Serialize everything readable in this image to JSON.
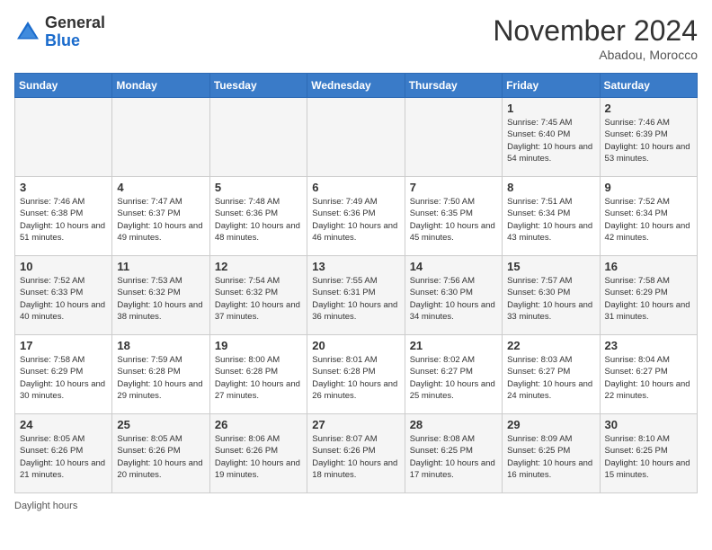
{
  "header": {
    "logo_general": "General",
    "logo_blue": "Blue",
    "month_title": "November 2024",
    "location": "Abadou, Morocco"
  },
  "footer": {
    "daylight_hours": "Daylight hours"
  },
  "weekdays": [
    "Sunday",
    "Monday",
    "Tuesday",
    "Wednesday",
    "Thursday",
    "Friday",
    "Saturday"
  ],
  "weeks": [
    [
      {
        "day": "",
        "info": ""
      },
      {
        "day": "",
        "info": ""
      },
      {
        "day": "",
        "info": ""
      },
      {
        "day": "",
        "info": ""
      },
      {
        "day": "",
        "info": ""
      },
      {
        "day": "1",
        "info": "Sunrise: 7:45 AM\nSunset: 6:40 PM\nDaylight: 10 hours and 54 minutes."
      },
      {
        "day": "2",
        "info": "Sunrise: 7:46 AM\nSunset: 6:39 PM\nDaylight: 10 hours and 53 minutes."
      }
    ],
    [
      {
        "day": "3",
        "info": "Sunrise: 7:46 AM\nSunset: 6:38 PM\nDaylight: 10 hours and 51 minutes."
      },
      {
        "day": "4",
        "info": "Sunrise: 7:47 AM\nSunset: 6:37 PM\nDaylight: 10 hours and 49 minutes."
      },
      {
        "day": "5",
        "info": "Sunrise: 7:48 AM\nSunset: 6:36 PM\nDaylight: 10 hours and 48 minutes."
      },
      {
        "day": "6",
        "info": "Sunrise: 7:49 AM\nSunset: 6:36 PM\nDaylight: 10 hours and 46 minutes."
      },
      {
        "day": "7",
        "info": "Sunrise: 7:50 AM\nSunset: 6:35 PM\nDaylight: 10 hours and 45 minutes."
      },
      {
        "day": "8",
        "info": "Sunrise: 7:51 AM\nSunset: 6:34 PM\nDaylight: 10 hours and 43 minutes."
      },
      {
        "day": "9",
        "info": "Sunrise: 7:52 AM\nSunset: 6:34 PM\nDaylight: 10 hours and 42 minutes."
      }
    ],
    [
      {
        "day": "10",
        "info": "Sunrise: 7:52 AM\nSunset: 6:33 PM\nDaylight: 10 hours and 40 minutes."
      },
      {
        "day": "11",
        "info": "Sunrise: 7:53 AM\nSunset: 6:32 PM\nDaylight: 10 hours and 38 minutes."
      },
      {
        "day": "12",
        "info": "Sunrise: 7:54 AM\nSunset: 6:32 PM\nDaylight: 10 hours and 37 minutes."
      },
      {
        "day": "13",
        "info": "Sunrise: 7:55 AM\nSunset: 6:31 PM\nDaylight: 10 hours and 36 minutes."
      },
      {
        "day": "14",
        "info": "Sunrise: 7:56 AM\nSunset: 6:30 PM\nDaylight: 10 hours and 34 minutes."
      },
      {
        "day": "15",
        "info": "Sunrise: 7:57 AM\nSunset: 6:30 PM\nDaylight: 10 hours and 33 minutes."
      },
      {
        "day": "16",
        "info": "Sunrise: 7:58 AM\nSunset: 6:29 PM\nDaylight: 10 hours and 31 minutes."
      }
    ],
    [
      {
        "day": "17",
        "info": "Sunrise: 7:58 AM\nSunset: 6:29 PM\nDaylight: 10 hours and 30 minutes."
      },
      {
        "day": "18",
        "info": "Sunrise: 7:59 AM\nSunset: 6:28 PM\nDaylight: 10 hours and 29 minutes."
      },
      {
        "day": "19",
        "info": "Sunrise: 8:00 AM\nSunset: 6:28 PM\nDaylight: 10 hours and 27 minutes."
      },
      {
        "day": "20",
        "info": "Sunrise: 8:01 AM\nSunset: 6:28 PM\nDaylight: 10 hours and 26 minutes."
      },
      {
        "day": "21",
        "info": "Sunrise: 8:02 AM\nSunset: 6:27 PM\nDaylight: 10 hours and 25 minutes."
      },
      {
        "day": "22",
        "info": "Sunrise: 8:03 AM\nSunset: 6:27 PM\nDaylight: 10 hours and 24 minutes."
      },
      {
        "day": "23",
        "info": "Sunrise: 8:04 AM\nSunset: 6:27 PM\nDaylight: 10 hours and 22 minutes."
      }
    ],
    [
      {
        "day": "24",
        "info": "Sunrise: 8:05 AM\nSunset: 6:26 PM\nDaylight: 10 hours and 21 minutes."
      },
      {
        "day": "25",
        "info": "Sunrise: 8:05 AM\nSunset: 6:26 PM\nDaylight: 10 hours and 20 minutes."
      },
      {
        "day": "26",
        "info": "Sunrise: 8:06 AM\nSunset: 6:26 PM\nDaylight: 10 hours and 19 minutes."
      },
      {
        "day": "27",
        "info": "Sunrise: 8:07 AM\nSunset: 6:26 PM\nDaylight: 10 hours and 18 minutes."
      },
      {
        "day": "28",
        "info": "Sunrise: 8:08 AM\nSunset: 6:25 PM\nDaylight: 10 hours and 17 minutes."
      },
      {
        "day": "29",
        "info": "Sunrise: 8:09 AM\nSunset: 6:25 PM\nDaylight: 10 hours and 16 minutes."
      },
      {
        "day": "30",
        "info": "Sunrise: 8:10 AM\nSunset: 6:25 PM\nDaylight: 10 hours and 15 minutes."
      }
    ]
  ]
}
